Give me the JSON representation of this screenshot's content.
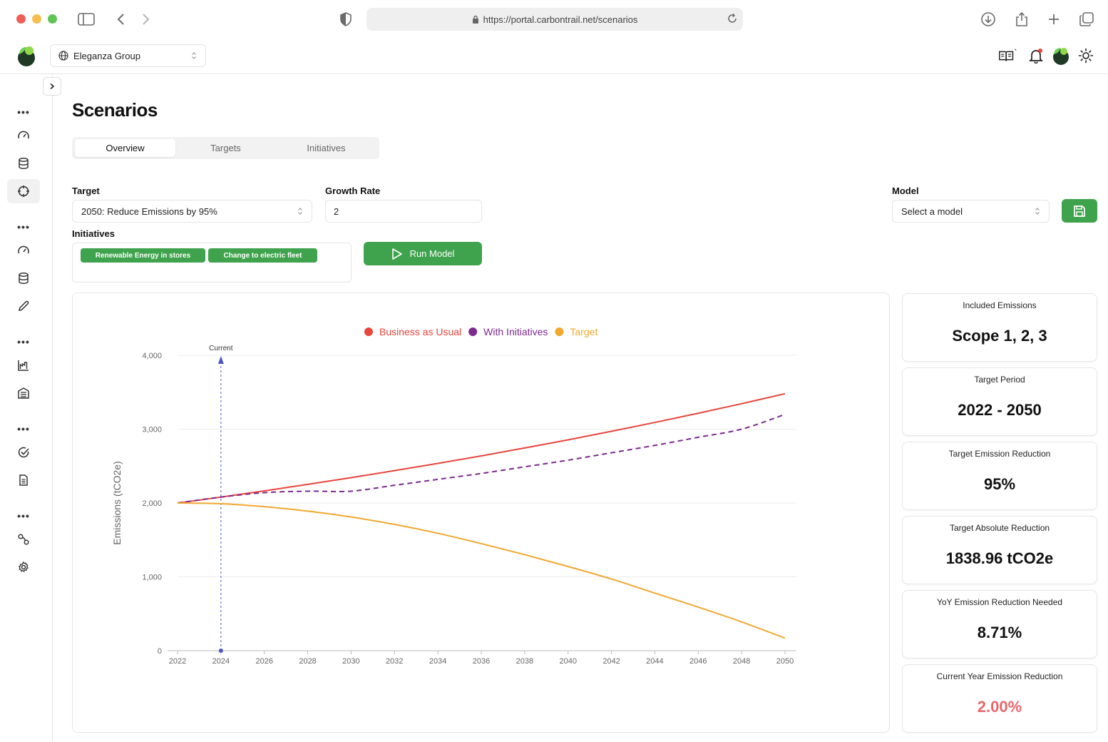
{
  "browser": {
    "url": "https://portal.carbontrail.net/scenarios"
  },
  "header": {
    "org_name": "Eleganza Group"
  },
  "page": {
    "title": "Scenarios",
    "tabs": [
      {
        "label": "Overview",
        "active": true
      },
      {
        "label": "Targets",
        "active": false
      },
      {
        "label": "Initiatives",
        "active": false
      }
    ]
  },
  "form": {
    "target_label": "Target",
    "target_value": "2050: Reduce Emissions by 95%",
    "growth_label": "Growth Rate",
    "growth_value": "2",
    "model_label": "Model",
    "model_placeholder": "Select a model",
    "initiatives_label": "Initiatives",
    "initiatives": [
      "Renewable Energy in stores",
      "Change to electric fleet"
    ],
    "run_label": "Run Model"
  },
  "stats": [
    {
      "label": "Included Emissions",
      "value": "Scope 1, 2, 3"
    },
    {
      "label": "Target Period",
      "value": "2022 - 2050"
    },
    {
      "label": "Target Emission Reduction",
      "value": "95%"
    },
    {
      "label": "Target Absolute Reduction",
      "value": "1838.96 tCO2e"
    },
    {
      "label": "YoY Emission Reduction Needed",
      "value": "8.71%"
    },
    {
      "label": "Current Year Emission Reduction",
      "value": "2.00%"
    }
  ],
  "colors": {
    "accent_green": "#3fa34d",
    "bau_red": "#e8453c",
    "initiatives_purple": "#7b2a8e",
    "target_orange": "#f0a830",
    "current_marker_blue": "#4a55c8",
    "warning_red": "#e8676a"
  },
  "chart_data": {
    "type": "line",
    "ylabel": "Emissions (tCO2e)",
    "ylim": [
      0,
      4000
    ],
    "yticks": [
      "0",
      "1,000",
      "2,000",
      "3,000",
      "4,000"
    ],
    "ytick_values": [
      0,
      1000,
      2000,
      3000,
      4000
    ],
    "xlim": [
      2022,
      2050
    ],
    "xticks": [
      2022,
      2024,
      2026,
      2028,
      2030,
      2032,
      2034,
      2036,
      2038,
      2040,
      2042,
      2044,
      2046,
      2048,
      2050
    ],
    "legend_position": "top-center",
    "current_marker": {
      "label": "Current",
      "x": 2024
    },
    "series": [
      {
        "name": "Business as Usual",
        "color": "#e8453c",
        "dashed": false,
        "x": [
          2022,
          2024,
          2026,
          2028,
          2030,
          2032,
          2034,
          2036,
          2038,
          2040,
          2042,
          2044,
          2046,
          2048,
          2050
        ],
        "values": [
          2000,
          2080,
          2164,
          2252,
          2343,
          2438,
          2536,
          2638,
          2745,
          2855,
          2971,
          3091,
          3215,
          3345,
          3480
        ]
      },
      {
        "name": "With Initiatives",
        "color": "#7b2a8e",
        "dashed": true,
        "x": [
          2022,
          2024,
          2026,
          2028,
          2030,
          2032,
          2034,
          2036,
          2038,
          2040,
          2042,
          2044,
          2046,
          2048,
          2050
        ],
        "values": [
          2000,
          2080,
          2140,
          2160,
          2160,
          2240,
          2320,
          2400,
          2490,
          2580,
          2680,
          2780,
          2890,
          3000,
          3200
        ]
      },
      {
        "name": "Target",
        "color": "#f0a830",
        "dashed": false,
        "x": [
          2022,
          2024,
          2026,
          2028,
          2030,
          2032,
          2034,
          2036,
          2038,
          2040,
          2042,
          2044,
          2046,
          2048,
          2050
        ],
        "values": [
          2000,
          1990,
          1950,
          1890,
          1810,
          1710,
          1590,
          1450,
          1300,
          1140,
          970,
          780,
          590,
          390,
          170
        ]
      }
    ]
  }
}
